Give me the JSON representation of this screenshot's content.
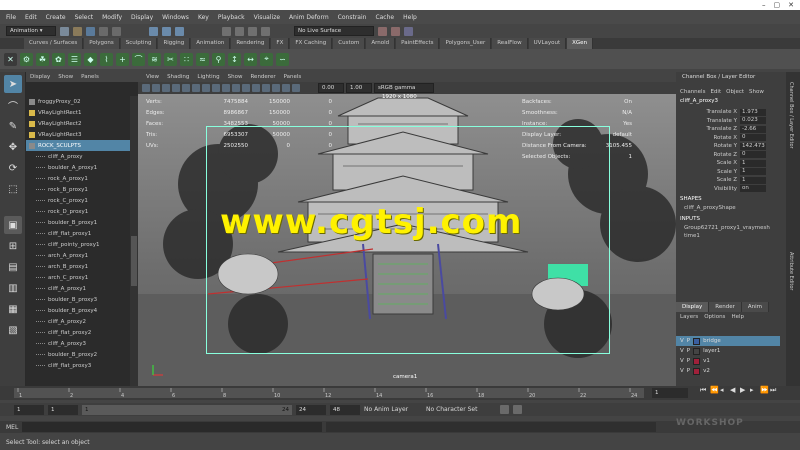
{
  "menubar": [
    "File",
    "Edit",
    "Create",
    "Select",
    "Modify",
    "Display",
    "Windows",
    "Key",
    "Playback",
    "Visualize",
    "Anim Deform",
    "Constrain",
    "Cache",
    "Help"
  ],
  "status": {
    "mode": "Animation",
    "live_surface": "No Live Surface"
  },
  "shelf_tabs": [
    "Curves / Surfaces",
    "Polygons",
    "Sculpting",
    "Rigging",
    "Animation",
    "Rendering",
    "FX",
    "FX Caching",
    "Custom",
    "Arnold",
    "PaintEffects",
    "Polygons_User",
    "RealFlow",
    "UVLayout",
    "XGen"
  ],
  "shelf_active": "XGen",
  "outliner": {
    "menu": [
      "Display",
      "Show",
      "Panels"
    ],
    "items": [
      {
        "label": "froggyProxy_02",
        "type": "group"
      },
      {
        "label": "VRayLightRect1",
        "type": "light"
      },
      {
        "label": "VRayLightRect2",
        "type": "light"
      },
      {
        "label": "VRayLightRect3",
        "type": "light"
      },
      {
        "label": "ROCK_SCULPTS",
        "type": "group",
        "selected": true
      },
      {
        "label": "cliff_A_proxy",
        "type": "child"
      },
      {
        "label": "boulder_A_proxy1",
        "type": "child"
      },
      {
        "label": "rock_A_proxy1",
        "type": "child"
      },
      {
        "label": "rock_B_proxy1",
        "type": "child"
      },
      {
        "label": "rock_C_proxy1",
        "type": "child"
      },
      {
        "label": "rock_D_proxy1",
        "type": "child"
      },
      {
        "label": "boulder_B_proxy1",
        "type": "child"
      },
      {
        "label": "cliff_flat_proxy1",
        "type": "child"
      },
      {
        "label": "cliff_pointy_proxy1",
        "type": "child"
      },
      {
        "label": "arch_A_proxy1",
        "type": "child"
      },
      {
        "label": "arch_B_proxy1",
        "type": "child"
      },
      {
        "label": "arch_C_proxy1",
        "type": "child"
      },
      {
        "label": "cliff_A_proxy1",
        "type": "child"
      },
      {
        "label": "boulder_B_proxy3",
        "type": "child"
      },
      {
        "label": "boulder_B_proxy4",
        "type": "child"
      },
      {
        "label": "cliff_A_proxy2",
        "type": "child"
      },
      {
        "label": "cliff_flat_proxy2",
        "type": "child"
      },
      {
        "label": "cliff_A_proxy3",
        "type": "child"
      },
      {
        "label": "boulder_B_proxy2",
        "type": "child"
      },
      {
        "label": "cliff_flat_proxy3",
        "type": "child"
      }
    ]
  },
  "viewport": {
    "menu": [
      "View",
      "Shading",
      "Lighting",
      "Show",
      "Renderer",
      "Panels"
    ],
    "colorspace": "sRGB gamma",
    "exposure": "0.00",
    "gamma": "1.00",
    "resolution": "1920 x 1080",
    "camera": "camera1",
    "hud_left": [
      {
        "k": "Verts:",
        "v1": "7475884",
        "v2": "150000",
        "v3": "0"
      },
      {
        "k": "Edges:",
        "v1": "8986867",
        "v2": "150000",
        "v3": "0"
      },
      {
        "k": "Faces:",
        "v1": "3482553",
        "v2": "50000",
        "v3": "0"
      },
      {
        "k": "Tris:",
        "v1": "6953307",
        "v2": "50000",
        "v3": "0"
      },
      {
        "k": "UVs:",
        "v1": "2502550",
        "v2": "0",
        "v3": "0"
      }
    ],
    "hud_right": [
      {
        "k": "Backfaces:",
        "v": "On"
      },
      {
        "k": "Smoothness:",
        "v": "N/A"
      },
      {
        "k": "Instance:",
        "v": "Yes"
      },
      {
        "k": "Display Layer:",
        "v": "default"
      },
      {
        "k": "Distance From Camera:",
        "v": "3105.455"
      },
      {
        "k": "Selected Objects:",
        "v": "1"
      }
    ],
    "watermark": "www.cgtsj.com"
  },
  "channel_box": {
    "title": "Channel Box / Layer Editor",
    "menu": [
      "Channels",
      "Edit",
      "Object",
      "Show"
    ],
    "object": "cliff_A_proxy3",
    "attrs": [
      {
        "n": "Translate X",
        "v": "1.973"
      },
      {
        "n": "Translate Y",
        "v": "0.023"
      },
      {
        "n": "Translate Z",
        "v": "-2.66"
      },
      {
        "n": "Rotate X",
        "v": "0"
      },
      {
        "n": "Rotate Y",
        "v": "142.473"
      },
      {
        "n": "Rotate Z",
        "v": "0"
      },
      {
        "n": "Scale X",
        "v": "1"
      },
      {
        "n": "Scale Y",
        "v": "1"
      },
      {
        "n": "Scale Z",
        "v": "1"
      },
      {
        "n": "Visibility",
        "v": "on"
      }
    ],
    "shapes_label": "SHAPES",
    "shape": "cliff_A_proxyShape",
    "inputs_label": "INPUTS",
    "inputs": [
      "Group62721_proxy1_vraymesh",
      "time1"
    ]
  },
  "layer_editor": {
    "tabs": [
      "Display",
      "Render",
      "Anim"
    ],
    "menu": [
      "Layers",
      "Options",
      "Help"
    ],
    "layers": [
      {
        "name": "bridge",
        "color": "#3a5fa0",
        "selected": true
      },
      {
        "name": "layer1",
        "color": "#444444"
      },
      {
        "name": "v1",
        "color": "#a0203a"
      },
      {
        "name": "v2",
        "color": "#a0203a"
      }
    ]
  },
  "timeline": {
    "ticks": [
      "1",
      "2",
      "4",
      "6",
      "8",
      "10",
      "12",
      "14",
      "16",
      "18",
      "20",
      "22",
      "24"
    ],
    "current": "1"
  },
  "range": {
    "start": "1",
    "inner_start": "1",
    "inner_start_mark": "1",
    "inner_end_mark": "24",
    "inner_end": "24",
    "end": "48",
    "anim_layer": "No Anim Layer",
    "char_set": "No Character Set"
  },
  "mel_label": "MEL",
  "help_text": "Select Tool: select an object",
  "brand": "WORKSHOP",
  "side_tab": "Channel Box / Layer Editor",
  "side_tab2": "Attribute Editor"
}
